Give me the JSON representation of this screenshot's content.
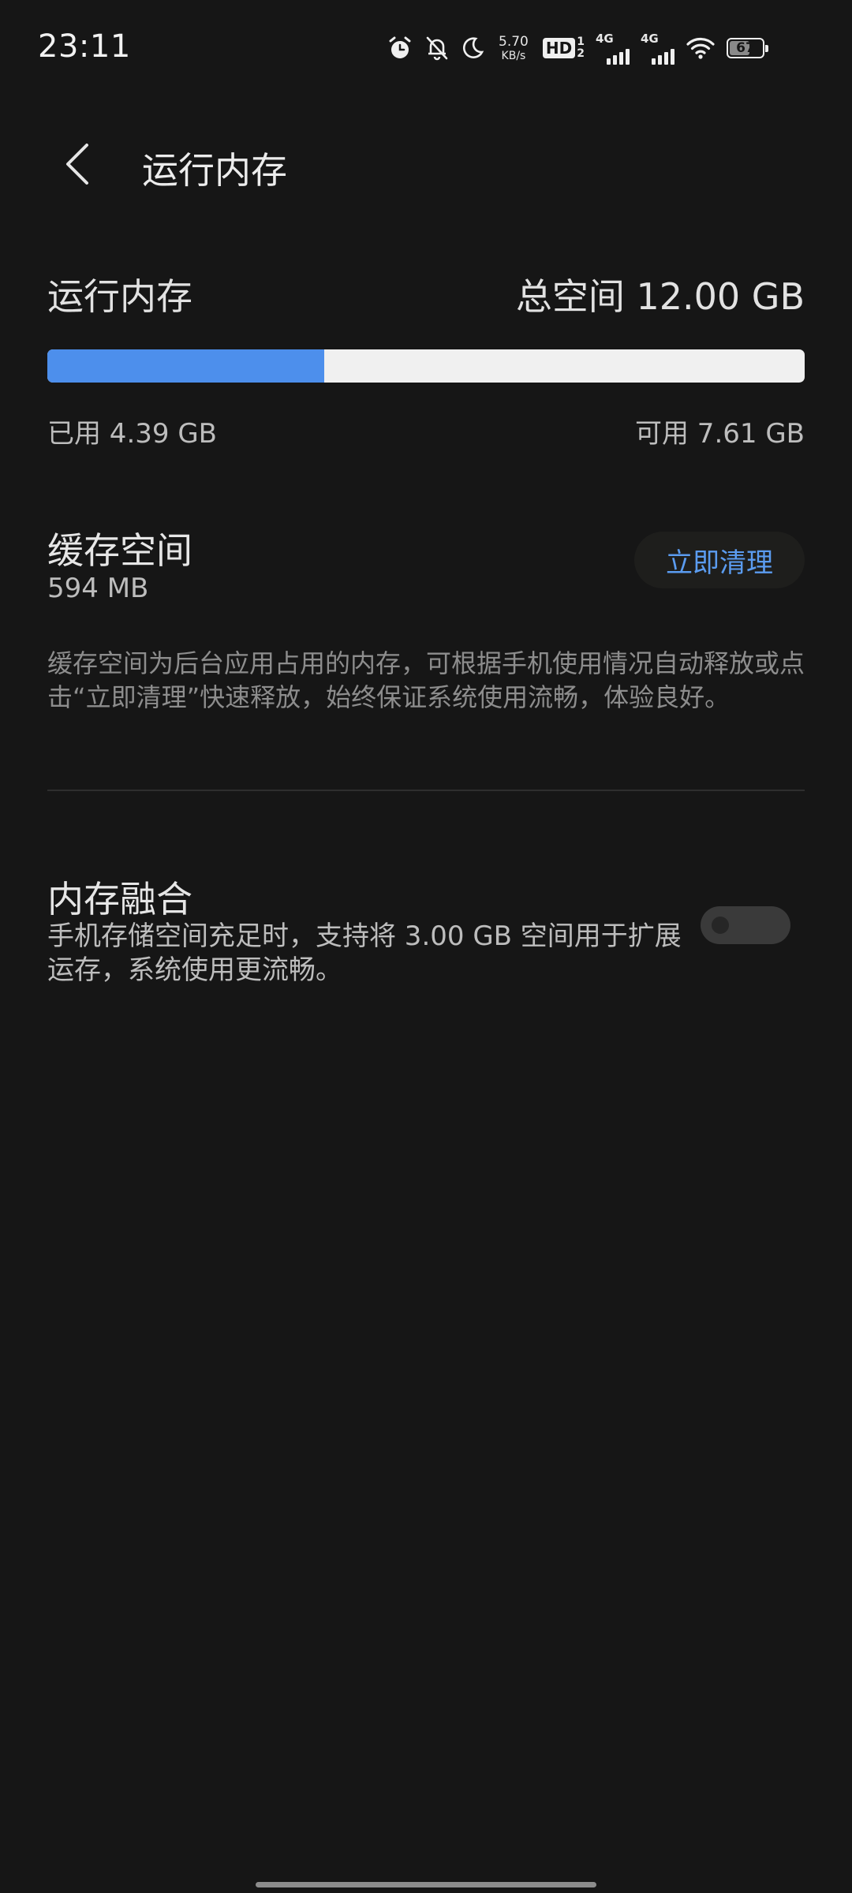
{
  "status_bar": {
    "time": "23:11",
    "net_speed_value": "5.70",
    "net_speed_unit": "KB/s",
    "hd_label": "HD",
    "hd_sim_top": "1",
    "hd_sim_bottom": "2",
    "signal1_label": "4G",
    "signal2_label": "4G",
    "battery_percent": "67",
    "battery_level": 0.67,
    "icons": [
      "alarm-icon",
      "bell-off-icon",
      "moon-icon",
      "wifi-icon",
      "battery-icon"
    ]
  },
  "header": {
    "title": "运行内存"
  },
  "memory": {
    "label": "运行内存",
    "total": "总空间 12.00 GB",
    "used_text": "已用 4.39 GB",
    "free_text": "可用 7.61 GB",
    "used_fraction": 0.3658,
    "used_color": "#4d8fec",
    "free_color": "#f0f0f0"
  },
  "cache": {
    "title": "缓存空间",
    "size": "594 MB",
    "clean_label": "立即清理",
    "description": "缓存空间为后台应用占用的内存，可根据手机使用情况自动释放或点击“立即清理”快速释放，始终保证系统使用流畅，体验良好。"
  },
  "fusion": {
    "title": "内存融合",
    "description": "手机存储空间充足时，支持将 3.00 GB 空间用于扩展运存，系统使用更流畅。",
    "enabled": false
  },
  "colors": {
    "background": "#161616",
    "accent": "#5b9cf0"
  }
}
